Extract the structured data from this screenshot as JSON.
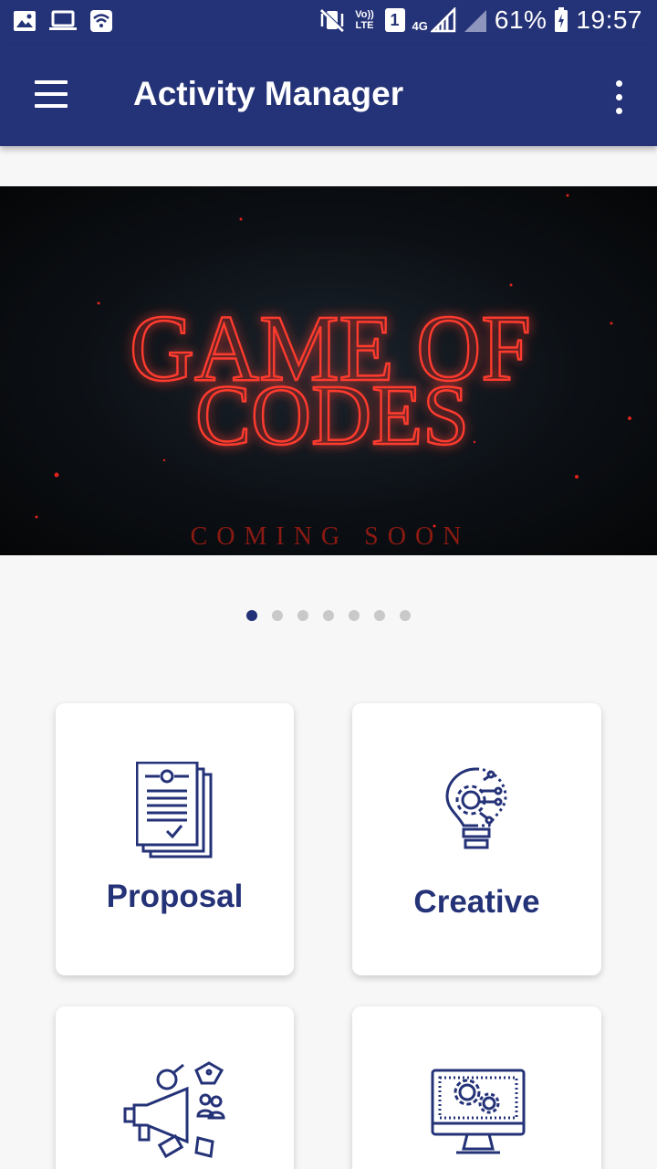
{
  "status_bar": {
    "icons_left": [
      "image-icon",
      "laptop-icon",
      "wifi-icon"
    ],
    "icons_right": [
      "mute-vibrate-icon",
      "volte-icon",
      "sim-1-icon",
      "4g-signal-icon",
      "signal-icon",
      "battery-icon"
    ],
    "volte_label": "Vo)) LTE",
    "sim_label": "1",
    "network_label": "4G",
    "battery": "61%",
    "time": "19:57"
  },
  "app_bar": {
    "title": "Activity Manager",
    "menu_icon": "hamburger-menu-icon",
    "overflow_icon": "more-vert-icon"
  },
  "banner": {
    "line1": "GAME OF",
    "line2": "CODES",
    "tagline": "COMING SOON",
    "slide_count": 7,
    "active_slide": 1
  },
  "cards": [
    {
      "label": "Proposal",
      "icon": "document-check-icon"
    },
    {
      "label": "Creative",
      "icon": "lightbulb-gear-icon"
    },
    {
      "label": "",
      "icon": "marketing-megaphone-icon"
    },
    {
      "label": "",
      "icon": "monitor-gears-icon"
    }
  ],
  "colors": {
    "primary": "#243277",
    "background": "#f7f7f7",
    "banner_red": "#e0231c",
    "dot_inactive": "#c9c9c9"
  }
}
